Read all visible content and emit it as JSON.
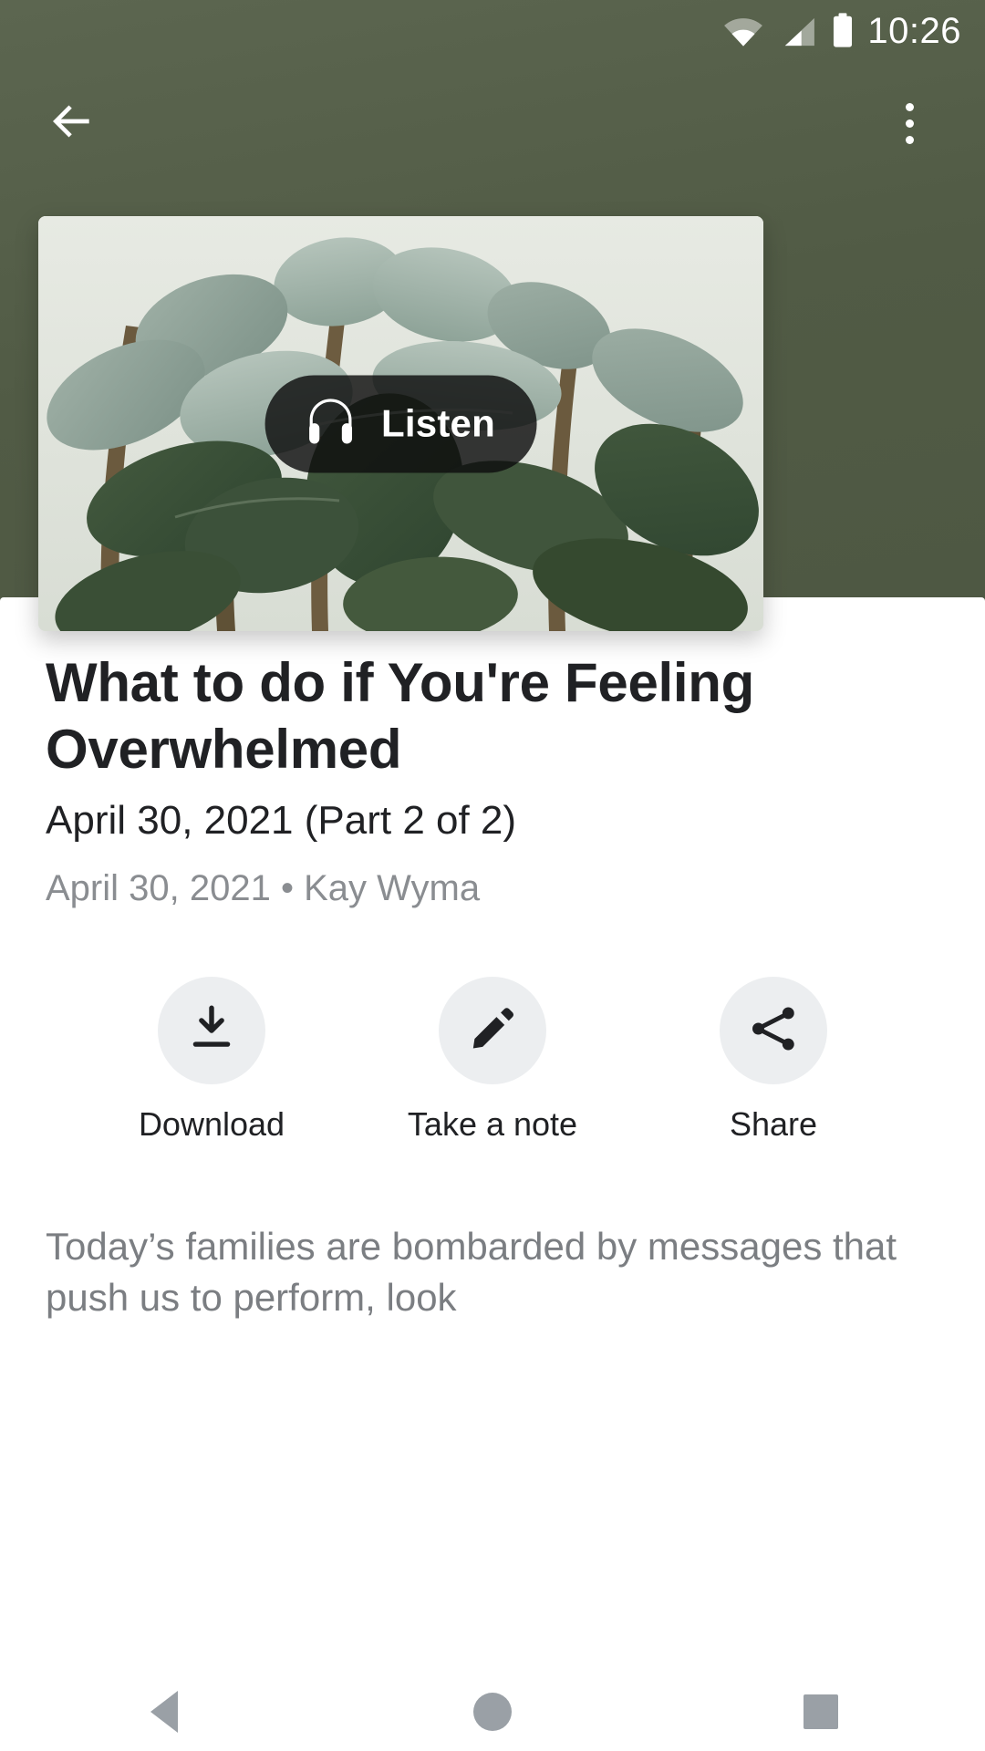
{
  "status_bar": {
    "time": "10:26",
    "icons": [
      "wifi-icon",
      "cell-signal-icon",
      "battery-icon"
    ]
  },
  "app_bar": {
    "back_icon": "back-arrow-icon",
    "overflow_icon": "more-vert-icon"
  },
  "hero": {
    "image_alt": "rubber plant leaves against a pale wall",
    "listen_button": {
      "label": "Listen",
      "icon": "headphones-icon"
    }
  },
  "article": {
    "title": "What to do if You're Feeling Overwhelmed",
    "subtitle": "April 30, 2021 (Part 2 of 2)",
    "byline": "April 30, 2021 • Kay Wyma",
    "body_excerpt": "Today’s families are bombarded by messages that push us to perform, look"
  },
  "actions": [
    {
      "label": "Download",
      "icon": "download-icon"
    },
    {
      "label": "Take a note",
      "icon": "pencil-icon"
    },
    {
      "label": "Share",
      "icon": "share-icon"
    }
  ],
  "nav_bar": {
    "back": "nav-back-icon",
    "home": "nav-home-icon",
    "recents": "nav-recents-icon"
  },
  "colors": {
    "hero_green": "#515b45",
    "sheet_white": "#ffffff",
    "title_text": "#202124",
    "muted_text": "#8a8d91",
    "body_text": "#7b7e82",
    "action_circle": "#eceef0",
    "pill_dark": "#0e0e0e",
    "nav_icon": "#9aa0a6"
  }
}
